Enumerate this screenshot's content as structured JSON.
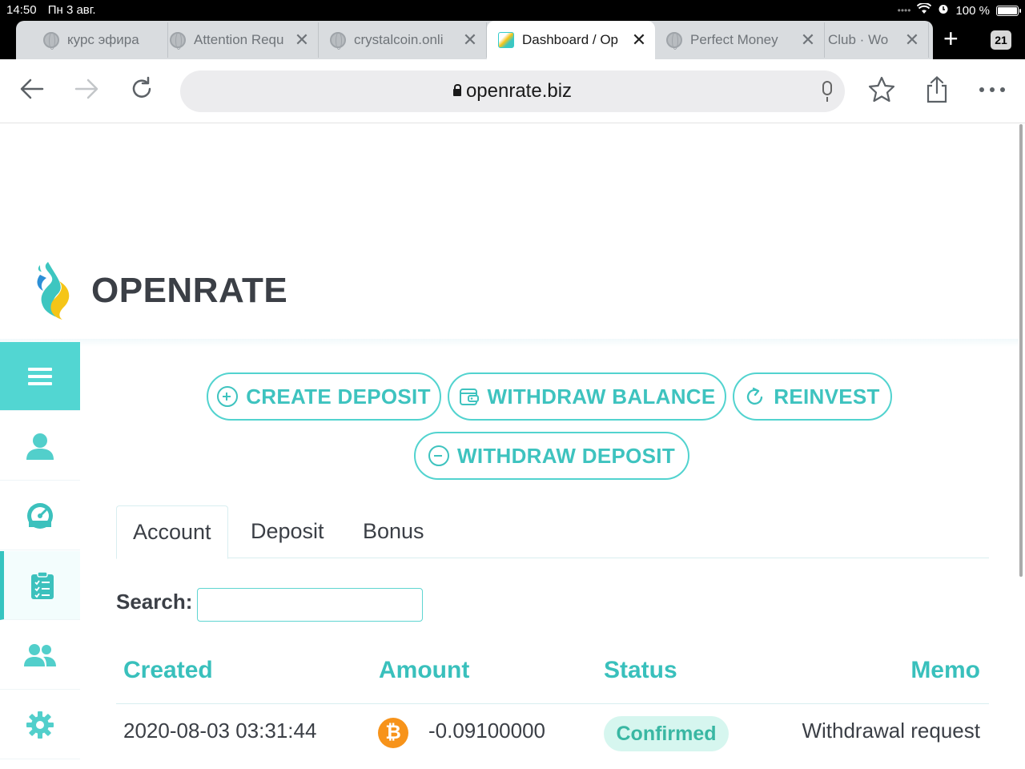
{
  "status_bar": {
    "time": "14:50",
    "date": "Пн 3 авг.",
    "battery": "100 %"
  },
  "browser": {
    "tabs": [
      {
        "title": "курс эфира"
      },
      {
        "title": "Attention Requ"
      },
      {
        "title": "crystalcoin.onli"
      },
      {
        "title": "Dashboard / Op"
      },
      {
        "title": "Perfect Money"
      },
      {
        "title": "Club · Wo"
      }
    ],
    "active_tab": 3,
    "tab_count": "21",
    "url": "openrate.biz"
  },
  "site": {
    "brand": "OPENRATE"
  },
  "sidebar": {
    "items": [
      {
        "icon": "menu-icon"
      },
      {
        "icon": "user-icon"
      },
      {
        "icon": "dashboard-gauge-icon"
      },
      {
        "icon": "clipboard-list-icon",
        "active": true
      },
      {
        "icon": "users-icon"
      },
      {
        "icon": "gear-icon"
      }
    ]
  },
  "actions": {
    "create_deposit": "CREATE DEPOSIT",
    "withdraw_balance": "WITHDRAW BALANCE",
    "reinvest": "REINVEST",
    "withdraw_deposit": "WITHDRAW DEPOSIT"
  },
  "history_tabs": [
    {
      "label": "Account",
      "active": true
    },
    {
      "label": "Deposit"
    },
    {
      "label": "Bonus"
    }
  ],
  "search": {
    "label": "Search:",
    "value": ""
  },
  "table": {
    "headers": {
      "created": "Created",
      "amount": "Amount",
      "status": "Status",
      "memo": "Memo"
    },
    "rows": [
      {
        "created": "2020-08-03 03:31:44",
        "currency_icon": "bitcoin-icon",
        "amount": "-0.09100000",
        "status": "Confirmed",
        "memo": "Withdrawal request"
      }
    ]
  },
  "colors": {
    "accent": "#3ec3bf",
    "sidebar_menu": "#52d6d2",
    "text": "#3b3f46",
    "badge_bg": "#d6f6ef",
    "bitcoin": "#f7931a"
  }
}
